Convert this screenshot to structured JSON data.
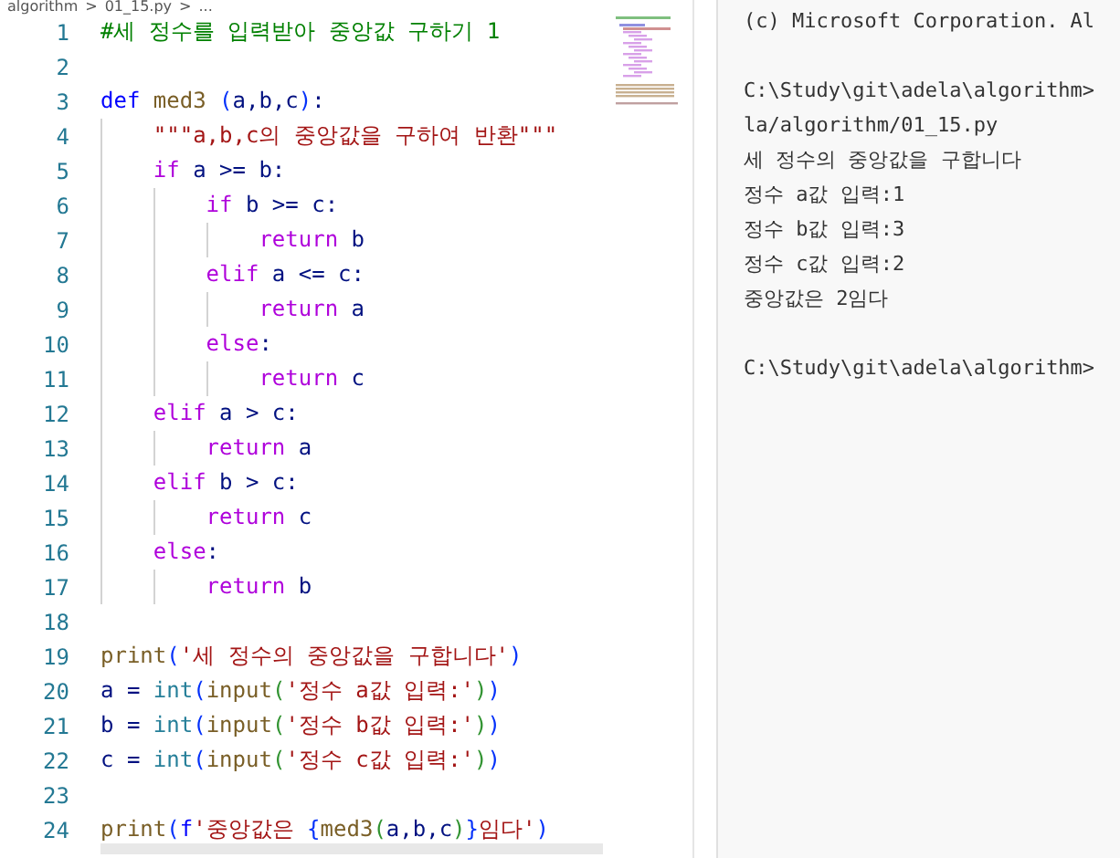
{
  "breadcrumb": [
    "algorithm",
    ">",
    "01_15.py",
    ">",
    "..."
  ],
  "editor": {
    "lines": [
      {
        "number": "1",
        "tokens": [
          {
            "kind": "comment",
            "text": "#세 정수를 입력받아 중앙값 구하기 1"
          }
        ]
      },
      {
        "number": "2"
      },
      {
        "number": "3",
        "tokens": [
          {
            "kind": "def",
            "text": "def"
          },
          {
            "kind": "func",
            "text": " med3 "
          },
          {
            "kind": "paren",
            "text": "("
          },
          {
            "kind": "var",
            "text": "a,b,c"
          },
          {
            "kind": "paren",
            "text": ")"
          },
          {
            "kind": "var",
            "text": ":"
          }
        ]
      },
      {
        "number": "4",
        "tokens": [
          {
            "kind": "string",
            "text": "    \"\"\"a,b,c의 중앙값을 구하여 반환\"\"\""
          }
        ]
      },
      {
        "number": "5",
        "tokens": [
          {
            "kind": "keyword",
            "text": "    if"
          },
          {
            "kind": "var",
            "text": " a >= b:"
          }
        ]
      },
      {
        "number": "6",
        "tokens": [
          {
            "kind": "keyword",
            "text": "        if"
          },
          {
            "kind": "var",
            "text": " b >= c:"
          }
        ]
      },
      {
        "number": "7",
        "tokens": [
          {
            "kind": "keyword",
            "text": "            return"
          },
          {
            "kind": "var",
            "text": " b"
          }
        ]
      },
      {
        "number": "8",
        "tokens": [
          {
            "kind": "keyword",
            "text": "        elif"
          },
          {
            "kind": "var",
            "text": " a <= c:"
          }
        ]
      },
      {
        "number": "9",
        "tokens": [
          {
            "kind": "keyword",
            "text": "            return"
          },
          {
            "kind": "var",
            "text": " a"
          }
        ]
      },
      {
        "number": "10",
        "tokens": [
          {
            "kind": "keyword",
            "text": "        else"
          },
          {
            "kind": "var",
            "text": ":"
          }
        ]
      },
      {
        "number": "11",
        "tokens": [
          {
            "kind": "keyword",
            "text": "            return"
          },
          {
            "kind": "var",
            "text": " c"
          }
        ]
      },
      {
        "number": "12",
        "tokens": [
          {
            "kind": "keyword",
            "text": "    elif"
          },
          {
            "kind": "var",
            "text": " a > c:"
          }
        ]
      },
      {
        "number": "13",
        "tokens": [
          {
            "kind": "keyword",
            "text": "        return"
          },
          {
            "kind": "var",
            "text": " a"
          }
        ]
      },
      {
        "number": "14",
        "tokens": [
          {
            "kind": "keyword",
            "text": "    elif"
          },
          {
            "kind": "var",
            "text": " b > c:"
          }
        ]
      },
      {
        "number": "15",
        "tokens": [
          {
            "kind": "keyword",
            "text": "        return"
          },
          {
            "kind": "var",
            "text": " c"
          }
        ]
      },
      {
        "number": "16",
        "tokens": [
          {
            "kind": "keyword",
            "text": "    else"
          },
          {
            "kind": "var",
            "text": ":"
          }
        ]
      },
      {
        "number": "17",
        "tokens": [
          {
            "kind": "keyword",
            "text": "        return"
          },
          {
            "kind": "var",
            "text": " b"
          }
        ]
      },
      {
        "number": "18"
      },
      {
        "number": "19",
        "tokens": [
          {
            "kind": "func",
            "text": "print"
          },
          {
            "kind": "paren",
            "text": "("
          },
          {
            "kind": "string",
            "text": "'세 정수의 중앙값을 구합니다'"
          },
          {
            "kind": "paren",
            "text": ")"
          }
        ]
      },
      {
        "number": "20",
        "tokens": [
          {
            "kind": "var",
            "text": "a = "
          },
          {
            "kind": "builtin",
            "text": "int"
          },
          {
            "kind": "paren",
            "text": "("
          },
          {
            "kind": "func",
            "text": "input"
          },
          {
            "kind": "paren2",
            "text": "("
          },
          {
            "kind": "string",
            "text": "'정수 a값 입력:'"
          },
          {
            "kind": "paren2",
            "text": ")"
          },
          {
            "kind": "paren",
            "text": ")"
          }
        ]
      },
      {
        "number": "21",
        "tokens": [
          {
            "kind": "var",
            "text": "b = "
          },
          {
            "kind": "builtin",
            "text": "int"
          },
          {
            "kind": "paren",
            "text": "("
          },
          {
            "kind": "func",
            "text": "input"
          },
          {
            "kind": "paren2",
            "text": "("
          },
          {
            "kind": "string",
            "text": "'정수 b값 입력:'"
          },
          {
            "kind": "paren2",
            "text": ")"
          },
          {
            "kind": "paren",
            "text": ")"
          }
        ]
      },
      {
        "number": "22",
        "tokens": [
          {
            "kind": "var",
            "text": "c = "
          },
          {
            "kind": "builtin",
            "text": "int"
          },
          {
            "kind": "paren",
            "text": "("
          },
          {
            "kind": "func",
            "text": "input"
          },
          {
            "kind": "paren2",
            "text": "("
          },
          {
            "kind": "string",
            "text": "'정수 c값 입력:'"
          },
          {
            "kind": "paren2",
            "text": ")"
          },
          {
            "kind": "paren",
            "text": ")"
          }
        ]
      },
      {
        "number": "23"
      },
      {
        "number": "24",
        "tokens": [
          {
            "kind": "func",
            "text": "print"
          },
          {
            "kind": "paren",
            "text": "("
          },
          {
            "kind": "def",
            "text": "f"
          },
          {
            "kind": "string",
            "text": "'중앙값은 "
          },
          {
            "kind": "paren",
            "text": "{"
          },
          {
            "kind": "func",
            "text": "med3"
          },
          {
            "kind": "paren2",
            "text": "("
          },
          {
            "kind": "var",
            "text": "a,b,c"
          },
          {
            "kind": "paren2",
            "text": ")"
          },
          {
            "kind": "paren",
            "text": "}"
          },
          {
            "kind": "string",
            "text": "임다'"
          },
          {
            "kind": "paren",
            "text": ")"
          }
        ]
      }
    ]
  },
  "terminal": {
    "blocks": [
      [
        "(c) Microsoft Corporation. Al"
      ],
      [
        "C:\\Study\\git\\adela\\algorithm>",
        "la/algorithm/01_15.py",
        "세 정수의 중앙값을 구합니다",
        "정수 a값 입력:1",
        "정수 b값 입력:3",
        "정수 c값 입력:2",
        "중앙값은 2임다"
      ],
      [
        "C:\\Study\\git\\adela\\algorithm>"
      ]
    ]
  }
}
